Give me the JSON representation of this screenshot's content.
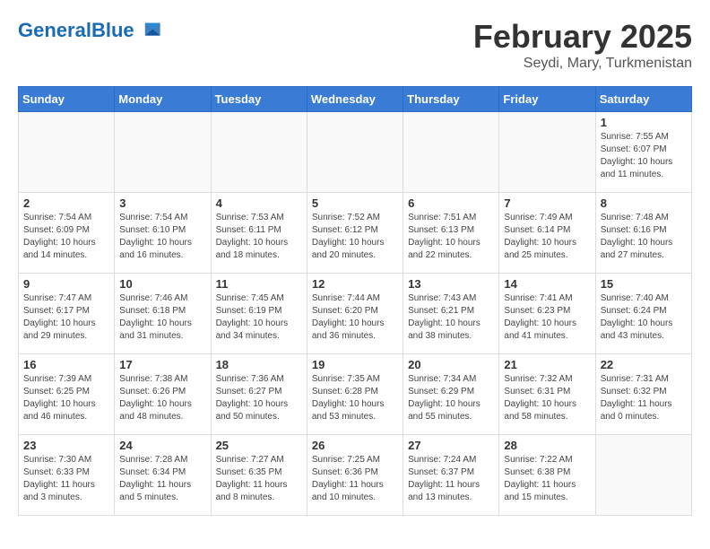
{
  "header": {
    "logo_general": "General",
    "logo_blue": "Blue",
    "month_title": "February 2025",
    "subtitle": "Seydi, Mary, Turkmenistan"
  },
  "days_of_week": [
    "Sunday",
    "Monday",
    "Tuesday",
    "Wednesday",
    "Thursday",
    "Friday",
    "Saturday"
  ],
  "weeks": [
    [
      {
        "day": "",
        "info": ""
      },
      {
        "day": "",
        "info": ""
      },
      {
        "day": "",
        "info": ""
      },
      {
        "day": "",
        "info": ""
      },
      {
        "day": "",
        "info": ""
      },
      {
        "day": "",
        "info": ""
      },
      {
        "day": "1",
        "info": "Sunrise: 7:55 AM\nSunset: 6:07 PM\nDaylight: 10 hours and 11 minutes."
      }
    ],
    [
      {
        "day": "2",
        "info": "Sunrise: 7:54 AM\nSunset: 6:09 PM\nDaylight: 10 hours and 14 minutes."
      },
      {
        "day": "3",
        "info": "Sunrise: 7:54 AM\nSunset: 6:10 PM\nDaylight: 10 hours and 16 minutes."
      },
      {
        "day": "4",
        "info": "Sunrise: 7:53 AM\nSunset: 6:11 PM\nDaylight: 10 hours and 18 minutes."
      },
      {
        "day": "5",
        "info": "Sunrise: 7:52 AM\nSunset: 6:12 PM\nDaylight: 10 hours and 20 minutes."
      },
      {
        "day": "6",
        "info": "Sunrise: 7:51 AM\nSunset: 6:13 PM\nDaylight: 10 hours and 22 minutes."
      },
      {
        "day": "7",
        "info": "Sunrise: 7:49 AM\nSunset: 6:14 PM\nDaylight: 10 hours and 25 minutes."
      },
      {
        "day": "8",
        "info": "Sunrise: 7:48 AM\nSunset: 6:16 PM\nDaylight: 10 hours and 27 minutes."
      }
    ],
    [
      {
        "day": "9",
        "info": "Sunrise: 7:47 AM\nSunset: 6:17 PM\nDaylight: 10 hours and 29 minutes."
      },
      {
        "day": "10",
        "info": "Sunrise: 7:46 AM\nSunset: 6:18 PM\nDaylight: 10 hours and 31 minutes."
      },
      {
        "day": "11",
        "info": "Sunrise: 7:45 AM\nSunset: 6:19 PM\nDaylight: 10 hours and 34 minutes."
      },
      {
        "day": "12",
        "info": "Sunrise: 7:44 AM\nSunset: 6:20 PM\nDaylight: 10 hours and 36 minutes."
      },
      {
        "day": "13",
        "info": "Sunrise: 7:43 AM\nSunset: 6:21 PM\nDaylight: 10 hours and 38 minutes."
      },
      {
        "day": "14",
        "info": "Sunrise: 7:41 AM\nSunset: 6:23 PM\nDaylight: 10 hours and 41 minutes."
      },
      {
        "day": "15",
        "info": "Sunrise: 7:40 AM\nSunset: 6:24 PM\nDaylight: 10 hours and 43 minutes."
      }
    ],
    [
      {
        "day": "16",
        "info": "Sunrise: 7:39 AM\nSunset: 6:25 PM\nDaylight: 10 hours and 46 minutes."
      },
      {
        "day": "17",
        "info": "Sunrise: 7:38 AM\nSunset: 6:26 PM\nDaylight: 10 hours and 48 minutes."
      },
      {
        "day": "18",
        "info": "Sunrise: 7:36 AM\nSunset: 6:27 PM\nDaylight: 10 hours and 50 minutes."
      },
      {
        "day": "19",
        "info": "Sunrise: 7:35 AM\nSunset: 6:28 PM\nDaylight: 10 hours and 53 minutes."
      },
      {
        "day": "20",
        "info": "Sunrise: 7:34 AM\nSunset: 6:29 PM\nDaylight: 10 hours and 55 minutes."
      },
      {
        "day": "21",
        "info": "Sunrise: 7:32 AM\nSunset: 6:31 PM\nDaylight: 10 hours and 58 minutes."
      },
      {
        "day": "22",
        "info": "Sunrise: 7:31 AM\nSunset: 6:32 PM\nDaylight: 11 hours and 0 minutes."
      }
    ],
    [
      {
        "day": "23",
        "info": "Sunrise: 7:30 AM\nSunset: 6:33 PM\nDaylight: 11 hours and 3 minutes."
      },
      {
        "day": "24",
        "info": "Sunrise: 7:28 AM\nSunset: 6:34 PM\nDaylight: 11 hours and 5 minutes."
      },
      {
        "day": "25",
        "info": "Sunrise: 7:27 AM\nSunset: 6:35 PM\nDaylight: 11 hours and 8 minutes."
      },
      {
        "day": "26",
        "info": "Sunrise: 7:25 AM\nSunset: 6:36 PM\nDaylight: 11 hours and 10 minutes."
      },
      {
        "day": "27",
        "info": "Sunrise: 7:24 AM\nSunset: 6:37 PM\nDaylight: 11 hours and 13 minutes."
      },
      {
        "day": "28",
        "info": "Sunrise: 7:22 AM\nSunset: 6:38 PM\nDaylight: 11 hours and 15 minutes."
      },
      {
        "day": "",
        "info": ""
      }
    ]
  ]
}
